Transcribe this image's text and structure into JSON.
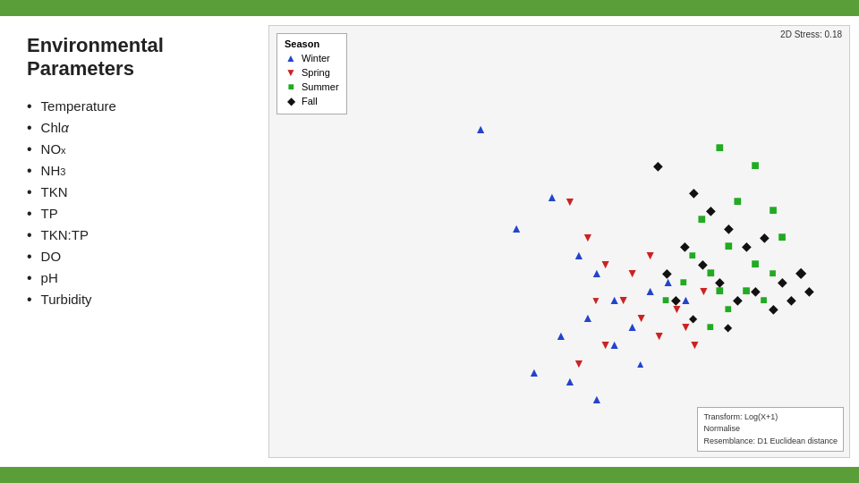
{
  "header": {
    "title": "Environmental Parameters"
  },
  "bullets": [
    {
      "text": "Temperature"
    },
    {
      "text": "Chl α"
    },
    {
      "text": "NOx"
    },
    {
      "text": "NH3"
    },
    {
      "text": "TKN"
    },
    {
      "text": "TP"
    },
    {
      "text": "TKN:TP"
    },
    {
      "text": "DO"
    },
    {
      "text": "pH"
    },
    {
      "text": "Turbidity"
    }
  ],
  "chart": {
    "stress_label": "2D Stress: 0.18",
    "legend_title": "Season",
    "seasons": [
      {
        "name": "Winter",
        "color": "#2244cc",
        "symbol": "▲"
      },
      {
        "name": "Spring",
        "color": "#cc2222",
        "symbol": "▼"
      },
      {
        "name": "Summer",
        "color": "#22aa22",
        "symbol": "■"
      },
      {
        "name": "Fall",
        "color": "#111111",
        "symbol": "◆"
      }
    ],
    "info": {
      "line1": "Transform: Log(X+1)",
      "line2": "Normalise",
      "line3": "Resemblance: D1 Euclidean distance"
    }
  }
}
